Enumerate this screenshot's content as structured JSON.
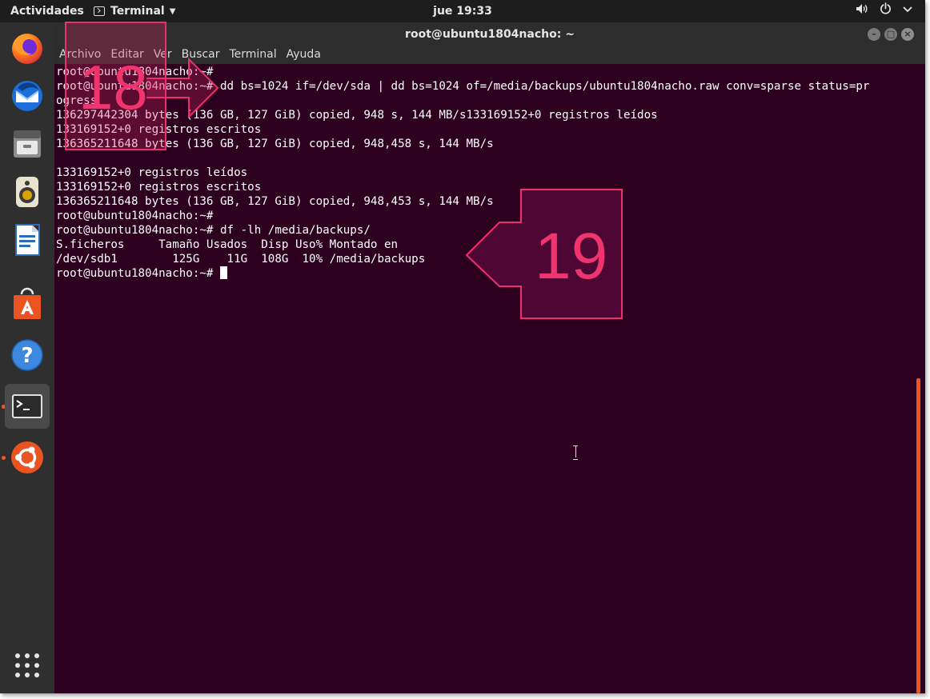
{
  "topbar": {
    "activities": "Actividades",
    "app_menu": "Terminal",
    "clock": "jue 19:33"
  },
  "dock": {
    "items": [
      {
        "name": "firefox"
      },
      {
        "name": "thunderbird"
      },
      {
        "name": "files"
      },
      {
        "name": "rhythmbox"
      },
      {
        "name": "libreoffice-writer"
      },
      {
        "name": "ubuntu-software"
      },
      {
        "name": "help"
      },
      {
        "name": "terminal",
        "active": true
      },
      {
        "name": "ubuntu-amazon"
      },
      {
        "name": "show-applications"
      }
    ]
  },
  "window": {
    "title": "root@ubuntu1804nacho: ~",
    "menu": [
      "Archivo",
      "Editar",
      "Ver",
      "Buscar",
      "Terminal",
      "Ayuda"
    ]
  },
  "terminal": {
    "lines": [
      "root@ubuntu1804nacho:~#",
      "root@ubuntu1804nacho:~# dd bs=1024 if=/dev/sda | dd bs=1024 of=/media/backups/ubuntu1804nacho.raw conv=sparse status=pr",
      "ogress",
      "136297442304 bytes (136 GB, 127 GiB) copied, 948 s, 144 MB/s133169152+0 registros leídos",
      "133169152+0 registros escritos",
      "136365211648 bytes (136 GB, 127 GiB) copied, 948,458 s, 144 MB/s",
      "",
      "133169152+0 registros leídos",
      "133169152+0 registros escritos",
      "136365211648 bytes (136 GB, 127 GiB) copied, 948,453 s, 144 MB/s",
      "root@ubuntu1804nacho:~#",
      "root@ubuntu1804nacho:~# df -lh /media/backups/",
      "S.ficheros     Tamaño Usados  Disp Uso% Montado en",
      "/dev/sdb1        125G    11G  108G  10% /media/backups"
    ],
    "prompt": "root@ubuntu1804nacho:~# "
  },
  "annotations": {
    "callout_18": "18",
    "callout_19": "19",
    "accent": "#ef2f6c"
  }
}
